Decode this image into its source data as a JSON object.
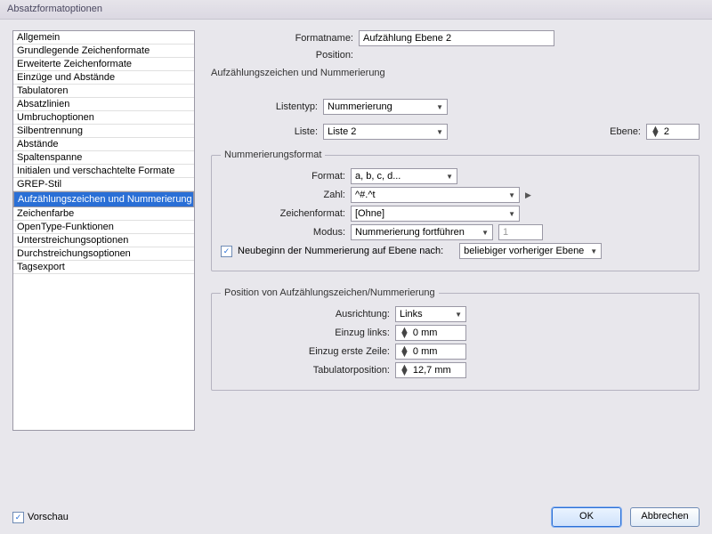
{
  "window": {
    "title": "Absatzformatoptionen"
  },
  "sidebar": {
    "items": [
      "Allgemein",
      "Grundlegende Zeichenformate",
      "Erweiterte Zeichenformate",
      "Einzüge und Abstände",
      "Tabulatoren",
      "Absatzlinien",
      "Umbruchoptionen",
      "Silbentrennung",
      "Abstände",
      "Spaltenspanne",
      "Initialen und verschachtelte Formate",
      "GREP-Stil",
      "Aufzählungszeichen und Nummerierung",
      "Zeichenfarbe",
      "OpenType-Funktionen",
      "Unterstreichungsoptionen",
      "Durchstreichungsoptionen",
      "Tagsexport"
    ],
    "selected_index": 12
  },
  "header": {
    "formatname_label": "Formatname:",
    "formatname_value": "Aufzählung Ebene 2",
    "position_label": "Position:",
    "section_title": "Aufzählungszeichen und Nummerierung"
  },
  "list": {
    "listentyp_label": "Listentyp:",
    "listentyp_value": "Nummerierung",
    "liste_label": "Liste:",
    "liste_value": "Liste 2",
    "ebene_label": "Ebene:",
    "ebene_value": "2"
  },
  "numfmt": {
    "legend": "Nummerierungsformat",
    "format_label": "Format:",
    "format_value": "a, b, c, d...",
    "zahl_label": "Zahl:",
    "zahl_value": "^#.^t",
    "zeichenformat_label": "Zeichenformat:",
    "zeichenformat_value": "[Ohne]",
    "modus_label": "Modus:",
    "modus_value": "Nummerierung fortführen",
    "modus_num": "1",
    "restart_label": "Neubeginn der Nummerierung auf Ebene nach:",
    "restart_value": "beliebiger vorheriger Ebene"
  },
  "pos": {
    "legend": "Position von Aufzählungszeichen/Nummerierung",
    "ausrichtung_label": "Ausrichtung:",
    "ausrichtung_value": "Links",
    "einzug_links_label": "Einzug links:",
    "einzug_links_value": "0 mm",
    "einzug_erste_label": "Einzug erste Zeile:",
    "einzug_erste_value": "0 mm",
    "tabpos_label": "Tabulatorposition:",
    "tabpos_value": "12,7 mm"
  },
  "footer": {
    "vorschau_label": "Vorschau",
    "ok": "OK",
    "cancel": "Abbrechen"
  }
}
